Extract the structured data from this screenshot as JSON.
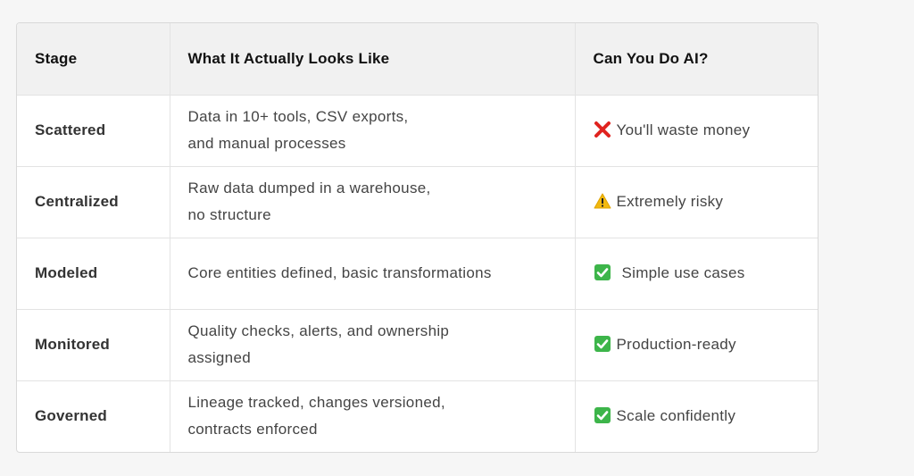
{
  "table": {
    "headers": {
      "stage": "Stage",
      "looks_like": "What It Actually Looks Like",
      "can_do_ai": "Can You Do AI?"
    },
    "rows": [
      {
        "stage": "Scattered",
        "desc_line1": "Data in 10+ tools, CSV exports,",
        "desc_line2": "and manual processes",
        "verdict_icon": "cross-mark-icon",
        "verdict": "You'll waste money"
      },
      {
        "stage": "Centralized",
        "desc_line1": "Raw data dumped in a warehouse,",
        "desc_line2": "no structure",
        "verdict_icon": "warning-icon",
        "verdict": "Extremely risky"
      },
      {
        "stage": "Modeled",
        "desc_line1": "Core entities defined, basic transformations",
        "desc_line2": "",
        "verdict_icon": "check-mark-icon",
        "verdict": "Simple use cases"
      },
      {
        "stage": "Monitored",
        "desc_line1": "Quality checks, alerts, and ownership",
        "desc_line2": "assigned",
        "verdict_icon": "check-mark-icon",
        "verdict": "Production-ready"
      },
      {
        "stage": "Governed",
        "desc_line1": "Lineage tracked, changes versioned,",
        "desc_line2": "contracts enforced",
        "verdict_icon": "check-mark-icon",
        "verdict": "Scale confidently"
      }
    ]
  },
  "colors": {
    "cross": "#e0231f",
    "warning": "#f2b90f",
    "check": "#3db54a"
  }
}
